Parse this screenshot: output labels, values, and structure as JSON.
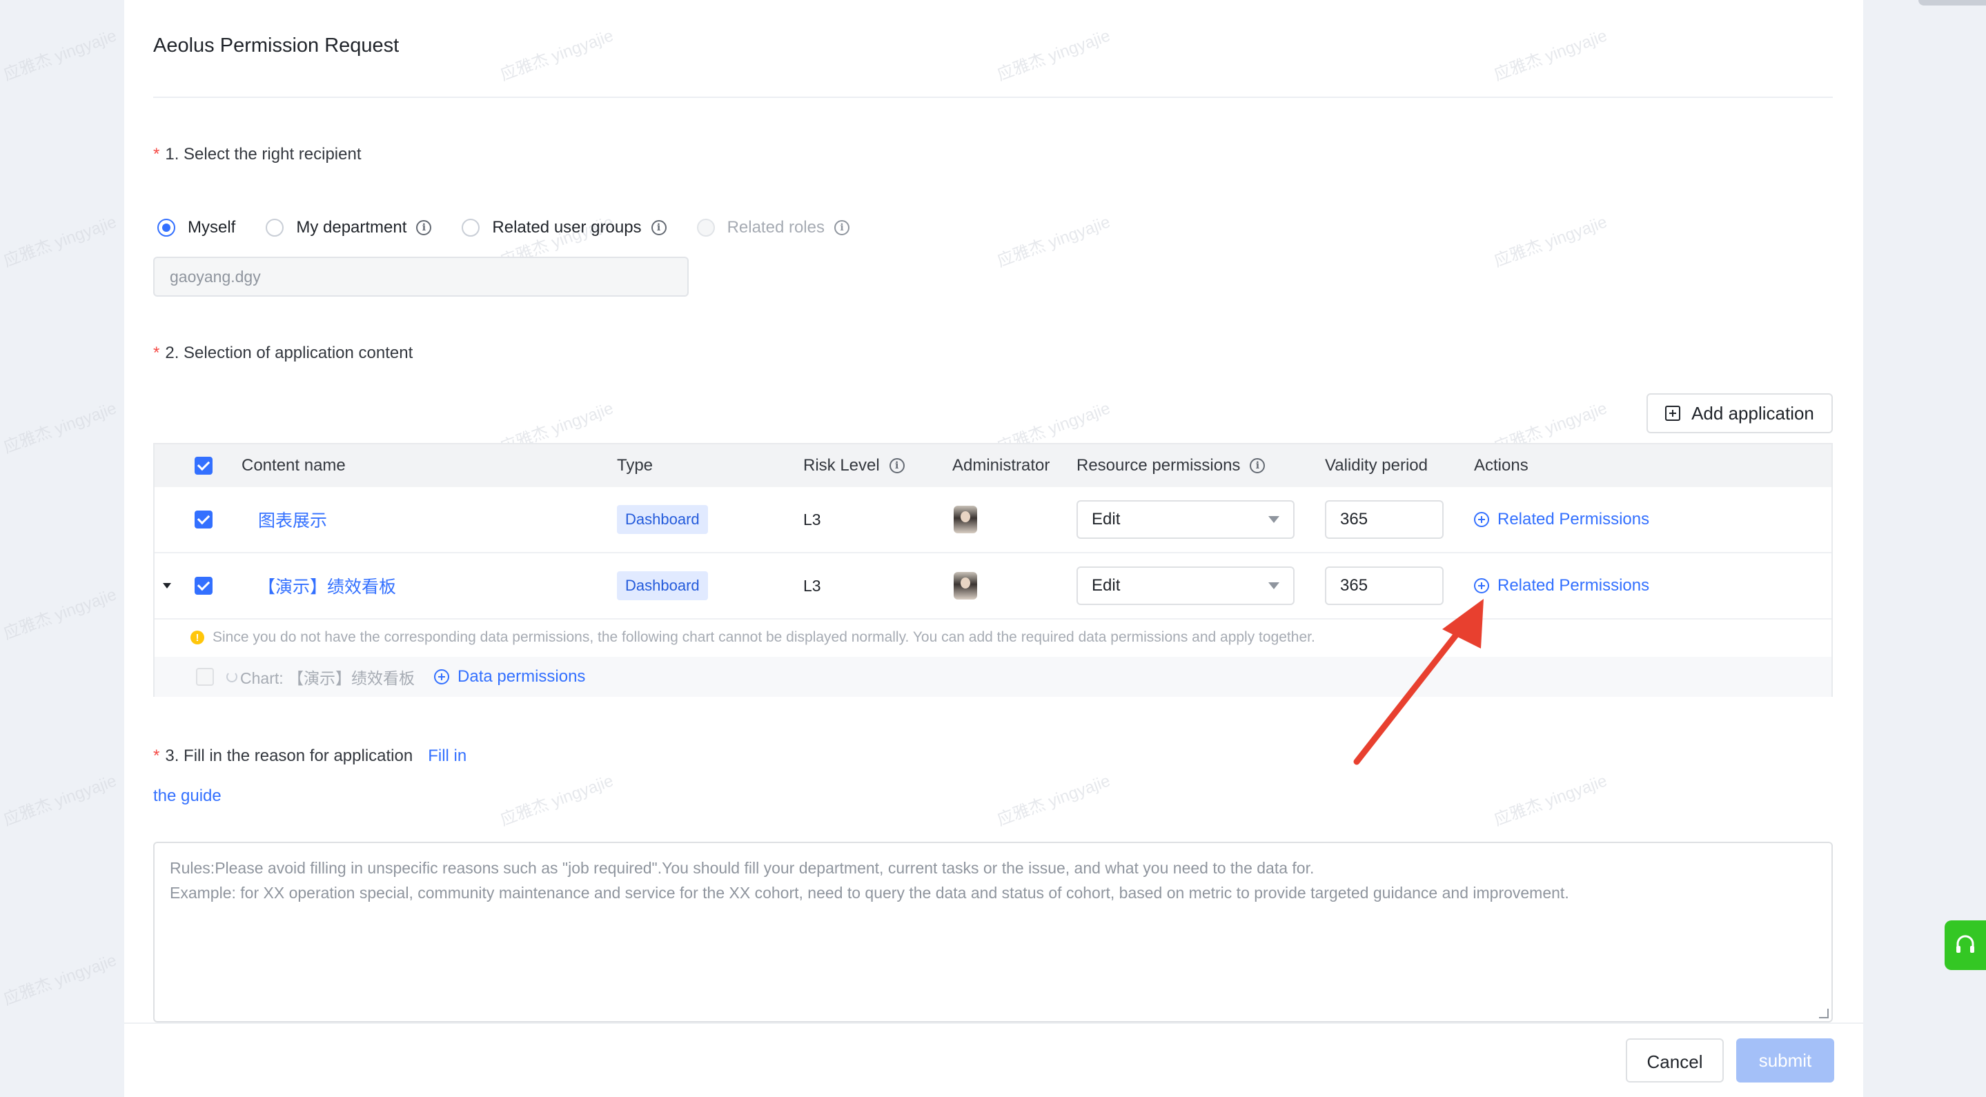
{
  "page": {
    "title": "Aeolus Permission Request",
    "watermark": "应雅杰 yingyajie"
  },
  "section1": {
    "required_mark": "*",
    "label": "1. Select the right recipient",
    "options": [
      {
        "label": "Myself",
        "checked": true,
        "disabled": false,
        "info": false
      },
      {
        "label": "My department",
        "checked": false,
        "disabled": false,
        "info": true
      },
      {
        "label": "Related user groups",
        "checked": false,
        "disabled": false,
        "info": true
      },
      {
        "label": "Related roles",
        "checked": false,
        "disabled": true,
        "info": true
      }
    ],
    "user_value": "gaoyang.dgy"
  },
  "section2": {
    "required_mark": "*",
    "label": "2. Selection of application content",
    "add_button": "Add application",
    "table": {
      "headers": {
        "content_name": "Content name",
        "type": "Type",
        "risk_level": "Risk Level",
        "administrator": "Administrator",
        "resource_permissions": "Resource permissions",
        "validity_period": "Validity period",
        "actions": "Actions"
      },
      "rows": [
        {
          "name": "图表展示",
          "type": "Dashboard",
          "risk": "L3",
          "permission": "Edit",
          "validity": "365",
          "action": "Related Permissions",
          "expandable": false
        },
        {
          "name": "【演示】绩效看板",
          "type": "Dashboard",
          "risk": "L3",
          "permission": "Edit",
          "validity": "365",
          "action": "Related Permissions",
          "expandable": true
        }
      ],
      "warning": "Since you do not have the corresponding data permissions, the following chart cannot be displayed normally. You can add the required data permissions and apply together.",
      "chart_item": {
        "name": "Chart: 【演示】绩效看板",
        "action": "Data permissions"
      }
    }
  },
  "section3": {
    "required_mark": "*",
    "label": "3. Fill in the reason for application",
    "guide_link_part1": "Fill in",
    "guide_link_part2": "the guide",
    "placeholder_line1": "Rules:Please avoid filling in unspecific reasons such as \"job required\".You should fill your department, current tasks or the issue, and what you need to the data for.",
    "placeholder_line2": "Example: for XX operation special, community maintenance and service for the XX cohort, need to query the data and status of cohort, based on metric to provide targeted guidance and improvement."
  },
  "footer": {
    "cancel": "Cancel",
    "submit": "submit"
  },
  "colors": {
    "accent": "#3370ff",
    "required": "#f54a45",
    "annotation_arrow": "#e8402f",
    "help_tab": "#34c724",
    "submit_disabled": "#a4c0f8"
  }
}
